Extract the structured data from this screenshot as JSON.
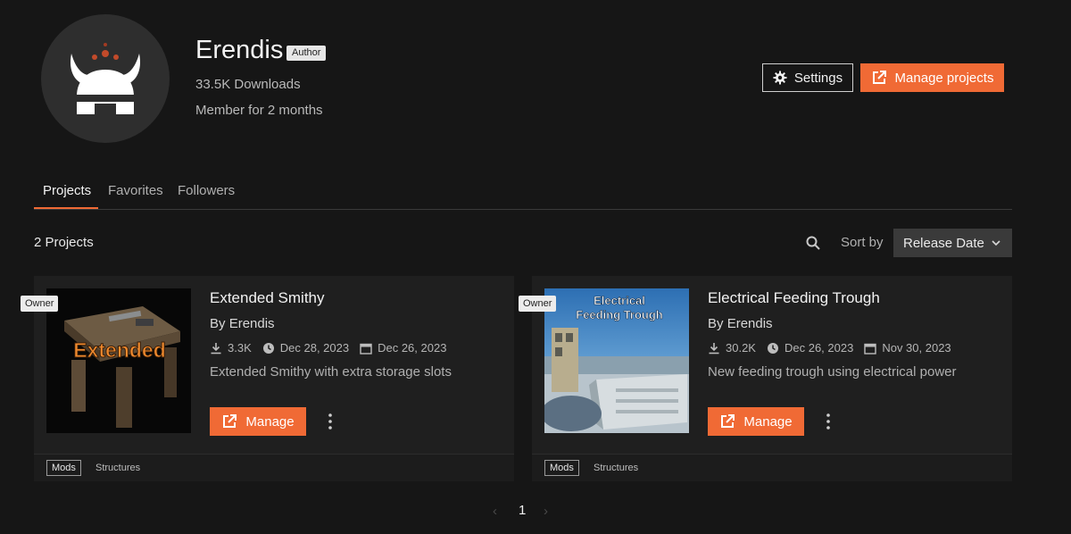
{
  "profile": {
    "username": "Erendis",
    "role_badge": "Author",
    "downloads": "33.5K Downloads",
    "member_since": "Member for 2 months"
  },
  "actions": {
    "settings_label": "Settings",
    "manage_projects_label": "Manage projects"
  },
  "tabs": [
    {
      "label": "Projects",
      "active": true
    },
    {
      "label": "Favorites",
      "active": false
    },
    {
      "label": "Followers",
      "active": false
    }
  ],
  "toolbar": {
    "project_count": "2 Projects",
    "sort_label": "Sort by",
    "sort_value": "Release Date"
  },
  "projects": [
    {
      "badge": "Owner",
      "title": "Extended Smithy",
      "by_label": "By",
      "author": "Erendis",
      "downloads": "3.3K",
      "updated": "Dec 28, 2023",
      "created": "Dec 26, 2023",
      "description": "Extended Smithy with extra storage slots",
      "manage_label": "Manage",
      "thumbnail_text": "Extended",
      "tag_primary": "Mods",
      "tag_secondary": "Structures"
    },
    {
      "badge": "Owner",
      "title": "Electrical Feeding Trough",
      "by_label": "By",
      "author": "Erendis",
      "downloads": "30.2K",
      "updated": "Dec 26, 2023",
      "created": "Nov 30, 2023",
      "description": "New feeding trough using electrical power",
      "manage_label": "Manage",
      "thumbnail_text_line1": "Electrical",
      "thumbnail_text_line2": "Feeding Trough",
      "tag_primary": "Mods",
      "tag_secondary": "Structures"
    }
  ],
  "pagination": {
    "prev": "‹",
    "current": "1",
    "next": "›"
  },
  "colors": {
    "accent": "#f06a35",
    "background": "#161616",
    "card": "#1f1f1f"
  }
}
